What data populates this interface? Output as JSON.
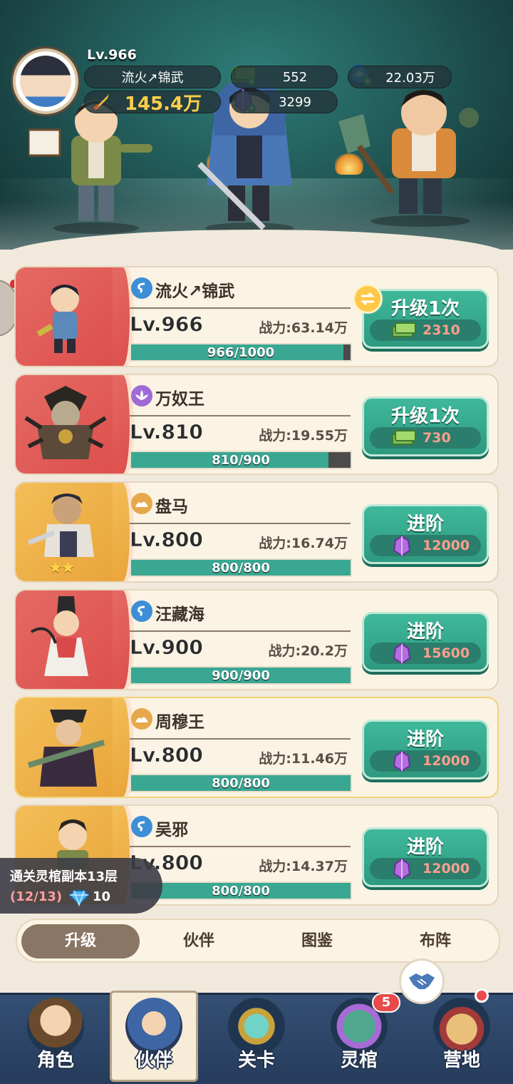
{
  "player": {
    "level": "Lv.966",
    "name": "流火↗锦武",
    "power": "145.4万",
    "cash": "552",
    "gems": "3299",
    "soul": "22.03万"
  },
  "partners": [
    {
      "faction": "water",
      "name": "流火↗锦武",
      "level": "Lv.966",
      "power": "战力:63.14万",
      "progress": "966/1000",
      "fraction": 0.966,
      "button": "升级1次",
      "cost_type": "cash",
      "cost": "2310",
      "frame": "red"
    },
    {
      "faction": "lotus",
      "name": "万奴王",
      "level": "Lv.810",
      "power": "战力:19.55万",
      "progress": "810/900",
      "fraction": 0.9,
      "button": "升级1次",
      "cost_type": "cash",
      "cost": "730",
      "frame": "red"
    },
    {
      "faction": "earth",
      "name": "盘马",
      "level": "Lv.800",
      "power": "战力:16.74万",
      "progress": "800/800",
      "fraction": 1.0,
      "button": "进阶",
      "cost_type": "gem",
      "cost": "12000",
      "frame": "gold"
    },
    {
      "faction": "water",
      "name": "汪藏海",
      "level": "Lv.900",
      "power": "战力:20.2万",
      "progress": "900/900",
      "fraction": 1.0,
      "button": "进阶",
      "cost_type": "gem",
      "cost": "15600",
      "frame": "red"
    },
    {
      "faction": "earth",
      "name": "周穆王",
      "level": "Lv.800",
      "power": "战力:11.46万",
      "progress": "800/800",
      "fraction": 1.0,
      "button": "进阶",
      "cost_type": "gem",
      "cost": "12000",
      "frame": "gold"
    },
    {
      "faction": "water",
      "name": "吴邪",
      "level": "Lv.800",
      "power": "战力:14.37万",
      "progress": "800/800",
      "fraction": 1.0,
      "button": "进阶",
      "cost_type": "gem",
      "cost": "12000",
      "frame": "gold"
    }
  ],
  "quest": {
    "title": "通关灵棺副本13层",
    "progress": "(12/13)",
    "reward": "10"
  },
  "subtabs": [
    "升级",
    "伙伴",
    "图鉴",
    "布阵"
  ],
  "active_subtab": 0,
  "nav": [
    {
      "label": "角色"
    },
    {
      "label": "伙伴"
    },
    {
      "label": "关卡"
    },
    {
      "label": "灵棺"
    },
    {
      "label": "营地"
    }
  ],
  "active_nav": 1,
  "nav_badge": "5",
  "colors": {
    "accent_green": "#3aa792",
    "red_frame": "#dd4e4c",
    "gold_frame": "#e9a43a",
    "nav_bg": "#2c4466"
  }
}
